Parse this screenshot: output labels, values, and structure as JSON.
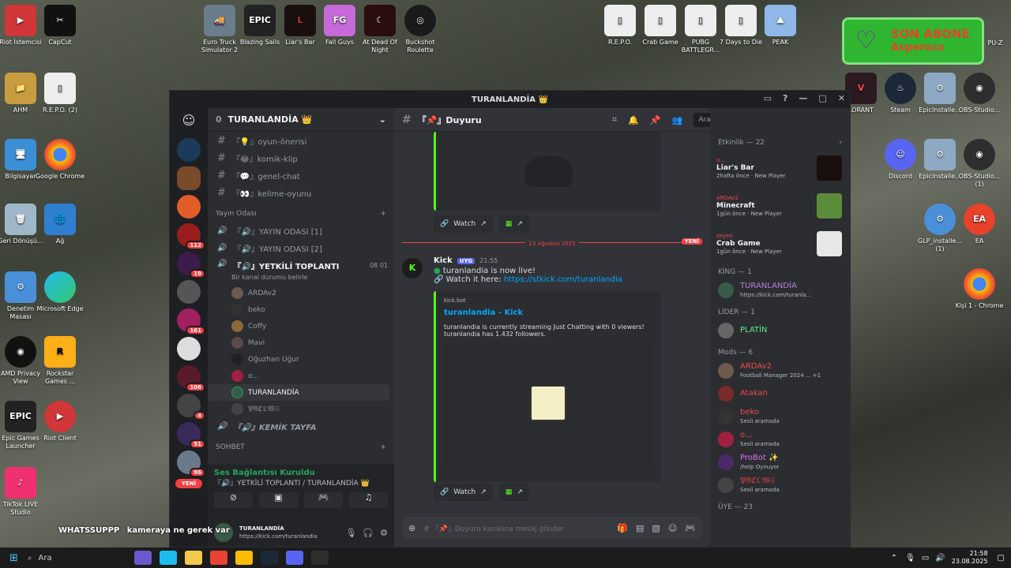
{
  "desktop_icons_left": [
    "Riot İstemcisi",
    "CapCut",
    "Bilgisayar",
    "Google Chrome",
    "Geri Dönüşü...",
    "Ağ",
    "Denetim Masası",
    "Microsoft Edge",
    "AMD Privacy View",
    "Rockstar Games ...",
    "Epic Games Launcher",
    "Riot Client",
    "TikTok LIVE Studio",
    "AHM",
    "R.E.P.O. (2)"
  ],
  "desktop_icons_top": [
    "Euro Truck Simulator 2",
    "Blazing Sails",
    "Liar's Bar",
    "Fall Guys",
    "At Dead Of Night",
    "Buckshot Roulette",
    "R.E.P.O.",
    "Crab Game",
    "PUBG BATTLEGR...",
    "7 Days to Die",
    "PEAK"
  ],
  "desktop_icons_right": [
    "LORANT",
    "Steam",
    "EpicInstalle...",
    "OBS-Studio...",
    "Discord",
    "EpicInstalle...",
    "OBS-Studio... (1)",
    "GLP_installe... (1)",
    "EA",
    "Kişi 1 - Chrome",
    "PU-Z"
  ],
  "sub_banner": {
    "line1": "SON ABONE",
    "line2": "Asperoxx"
  },
  "window": {
    "title": "TURANLANDİA 👑"
  },
  "server": {
    "name": "TURANLANDİA 👑",
    "count": "0"
  },
  "server_badges": [
    "112",
    "19",
    "161",
    "106",
    "4",
    "51",
    "96"
  ],
  "new_label": "YENİ",
  "text_channels": [
    "『💡』oyun-önerisi",
    "『😂』komik-klip",
    "『💬』genel-chat",
    "『👀』kelime-oyunu"
  ],
  "voice_category": "Yayın Odası",
  "voice_channels": [
    "『🔊』YAYIN ODASI [1]",
    "『🔊』YAYIN ODASI [2]"
  ],
  "active_voice": {
    "name": "『🔊』YETKİLİ TOPLANTI",
    "status": "Bir kanal durumu belirle",
    "count_a": "08",
    "count_b": "01"
  },
  "voice_users": [
    "ARDAv2",
    "beko",
    "Coffy",
    "Mavi",
    "Oğuzhan Uğur",
    "o...",
    "TURANLANDİA",
    "𝔓𝔄ℭ𝔒𝔚𝔖"
  ],
  "kemik": "『🔊』KEMİK TAYFA",
  "chat_category": "SOHBET",
  "voice_status": {
    "title": "Ses Bağlantısı Kuruldu",
    "sub": "『🔊』YETKİLİ TOPLANTI / TURANLANDİA 👑"
  },
  "user_panel": {
    "name": "TURANLANDİA",
    "url": "https://kick.com/turanlandia"
  },
  "chat_header": {
    "channel": "『📌』Duyuru",
    "search_placeholder": "Ara"
  },
  "date_divider": "23 Ağustos 2025",
  "new_badge": "YENİ",
  "message": {
    "author": "Kick",
    "tag": "UYG",
    "time": "21:55",
    "line1": "turanlandia is now live!",
    "line2_prefix": "Watch it here:",
    "link": "https://stkick.com/turanlandia",
    "embed_provider": "kick.bot",
    "embed_title": "turanlandia - Kick",
    "embed_desc1": "turanlandia is currently streaming Just Chatting with 0 viewers!",
    "embed_desc2": "turanlandia has 1.432 followers."
  },
  "watch_label": "Watch",
  "composer_placeholder": "# 『📌』Duyuru kanalına mesaj gönder",
  "members": {
    "activity_header": "Etkinlik — 22",
    "activities": [
      {
        "user": "o...",
        "game": "Liar's Bar",
        "when": "2hafta önce",
        "tag": "New Player"
      },
      {
        "user": "ARDAv2",
        "game": "Minecraft",
        "when": "1gün önce",
        "tag": "New Player"
      },
      {
        "user": "zeyen",
        "game": "Crab Game",
        "when": "1gün önce",
        "tag": "New Player"
      }
    ],
    "king_header": "KİNG — 1",
    "king": {
      "name": "TURANLANDİA",
      "status": "https://kick.com/turanla..."
    },
    "lider_header": "LİDER — 1",
    "lider": {
      "name": "PLATİN"
    },
    "mods_header": "Mods — 6",
    "mods": [
      {
        "name": "ARDAv2",
        "status": "Football Manager 2024 ... +1",
        "color": "#f0484b"
      },
      {
        "name": "Atakan",
        "status": "",
        "color": "#f0484b"
      },
      {
        "name": "beko",
        "status": "Sesli aramada",
        "color": "#f0484b"
      },
      {
        "name": "o...",
        "status": "Sesli aramada",
        "color": "#f0484b"
      },
      {
        "name": "ProBot ✨",
        "status": "/help Oynuyor",
        "color": "#e36cf7"
      },
      {
        "name": "𝔓𝔄ℭ𝔒𝔚𝔖",
        "status": "Sesli aramada",
        "color": "#f0484b"
      }
    ],
    "uye_header": "ÜYE — 23"
  },
  "overlay": {
    "a": "WHATSSUPPP",
    "b": "kameraya ne gerek var"
  },
  "taskbar": {
    "search": "Ara",
    "time": "21:58",
    "date": "23.08.2025"
  }
}
